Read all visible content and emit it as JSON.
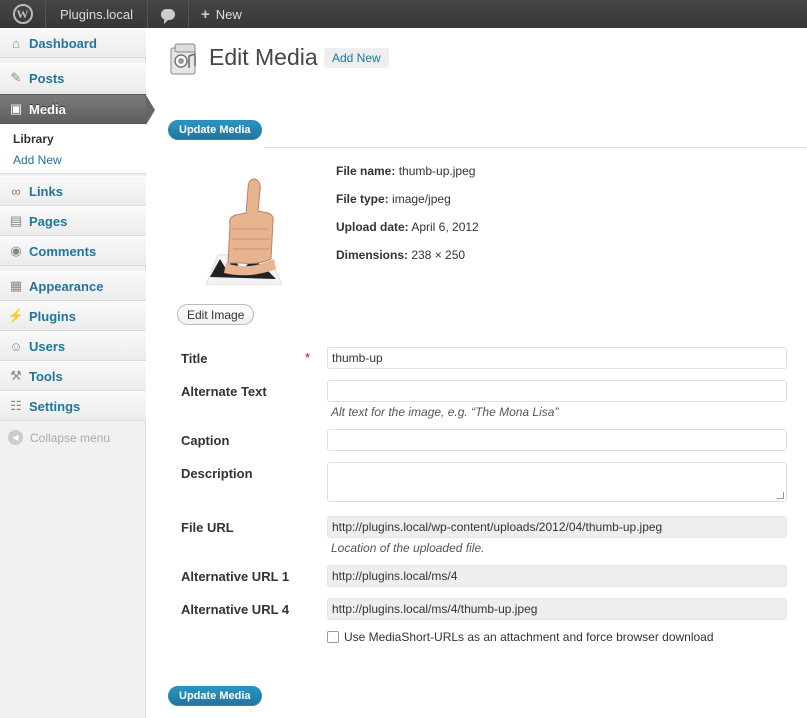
{
  "admin_bar": {
    "site_name": "Plugins.local",
    "new_label": "New"
  },
  "sidebar": {
    "items": [
      {
        "label": "Dashboard",
        "icon": "dashboard-icon"
      },
      {
        "label": "Posts",
        "icon": "pushpin-icon"
      },
      {
        "label": "Media",
        "icon": "media-icon",
        "current": true
      },
      {
        "label": "Links",
        "icon": "links-icon"
      },
      {
        "label": "Pages",
        "icon": "pages-icon"
      },
      {
        "label": "Comments",
        "icon": "comments-icon"
      },
      {
        "label": "Appearance",
        "icon": "appearance-icon"
      },
      {
        "label": "Plugins",
        "icon": "plugins-icon"
      },
      {
        "label": "Users",
        "icon": "users-icon"
      },
      {
        "label": "Tools",
        "icon": "tools-icon"
      },
      {
        "label": "Settings",
        "icon": "settings-icon"
      }
    ],
    "submenu": {
      "current": "Library",
      "link": "Add New"
    },
    "collapse_label": "Collapse menu"
  },
  "main": {
    "title": "Edit Media",
    "add_new_label": "Add New",
    "update_label": "Update Media",
    "file_info": {
      "file_name_label": "File name:",
      "file_name": "thumb-up.jpeg",
      "file_type_label": "File type:",
      "file_type": "image/jpeg",
      "upload_date_label": "Upload date:",
      "upload_date": "April 6, 2012",
      "dimensions_label": "Dimensions:",
      "dimensions": "238 × 250"
    },
    "edit_image_label": "Edit Image",
    "fields": {
      "title_label": "Title",
      "title_value": "thumb-up",
      "required_mark": "*",
      "alt_label": "Alternate Text",
      "alt_value": "",
      "alt_help": "Alt text for the image, e.g. “The Mona Lisa”",
      "caption_label": "Caption",
      "caption_value": "",
      "description_label": "Description",
      "description_value": "",
      "file_url_label": "File URL",
      "file_url_value": "http://plugins.local/wp-content/uploads/2012/04/thumb-up.jpeg",
      "file_url_help": "Location of the uploaded file.",
      "alt_url1_label": "Alternative URL 1",
      "alt_url1_value": "http://plugins.local/ms/4",
      "alt_url4_label": "Alternative URL 4",
      "alt_url4_value": "http://plugins.local/ms/4/thumb-up.jpeg",
      "checkbox_label": "Use MediaShort-URLs as an attachment and force browser download",
      "checkbox_checked": false
    }
  },
  "colors": {
    "accent": "#21759b",
    "admin_bar": "#464646",
    "button": "#21759b"
  }
}
